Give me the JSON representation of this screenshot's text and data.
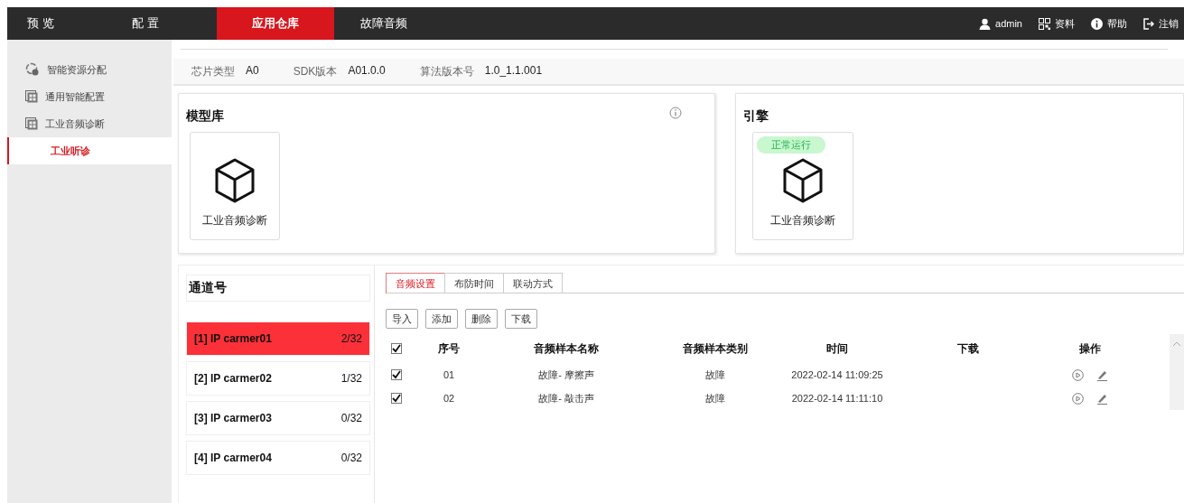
{
  "nav": {
    "tabs": [
      {
        "label": "预 览",
        "selected": false
      },
      {
        "label": "配 置",
        "selected": false
      },
      {
        "label": "应用仓库",
        "selected": true
      },
      {
        "label": "故障音频",
        "selected": false
      }
    ],
    "actions": [
      {
        "kind": "user",
        "label": "admin"
      },
      {
        "kind": "qr",
        "label": "资料"
      },
      {
        "kind": "help",
        "label": "帮助"
      },
      {
        "kind": "logout",
        "label": "注销"
      }
    ]
  },
  "sidebar": {
    "items": [
      {
        "label": "智能资源分配",
        "kind": "gear",
        "selected": false
      },
      {
        "label": "通用智能配置",
        "kind": "grid",
        "selected": false
      },
      {
        "label": "工业音频诊断",
        "kind": "grid",
        "selected": false,
        "children": [
          {
            "label": "工业听诊",
            "selected": true
          }
        ]
      }
    ]
  },
  "info": [
    {
      "label": "芯片类型",
      "value": "A0"
    },
    {
      "label": "SDK版本",
      "value": "A01.0.0"
    },
    {
      "label": "算法版本号",
      "value": "1.0_1.1.001"
    }
  ],
  "model_library": {
    "title": "模型库",
    "items": [
      {
        "label": "工业音频诊断"
      }
    ]
  },
  "engine": {
    "title": "引擎",
    "items": [
      {
        "status": "正常运行",
        "label": "工业音频诊断"
      }
    ]
  },
  "channels": {
    "title": "通道号",
    "items": [
      {
        "name": "[1] IP carmer01",
        "count": "2/32",
        "selected": true
      },
      {
        "name": "[2] IP carmer02",
        "count": "1/32",
        "selected": false
      },
      {
        "name": "[3] IP carmer03",
        "count": "0/32",
        "selected": false
      },
      {
        "name": "[4] IP carmer04",
        "count": "0/32",
        "selected": false
      }
    ]
  },
  "sub_tabs": [
    {
      "label": "音频设置",
      "selected": true
    },
    {
      "label": "布防时间",
      "selected": false
    },
    {
      "label": "联动方式",
      "selected": false
    }
  ],
  "toolbar": [
    "导入",
    "添加",
    "删除",
    "下载"
  ],
  "table": {
    "all_checked": true,
    "columns": [
      "序号",
      "音频样本名称",
      "音频样本类别",
      "时间",
      "下载",
      "操作"
    ],
    "rows": [
      {
        "checked": true,
        "cells": [
          "01",
          "故障- 摩擦声",
          "故障",
          "2022-02-14 11:09:25"
        ]
      },
      {
        "checked": true,
        "cells": [
          "02",
          "故障- 敲击声",
          "故障",
          "2022-02-14 11:11:10"
        ]
      }
    ]
  }
}
